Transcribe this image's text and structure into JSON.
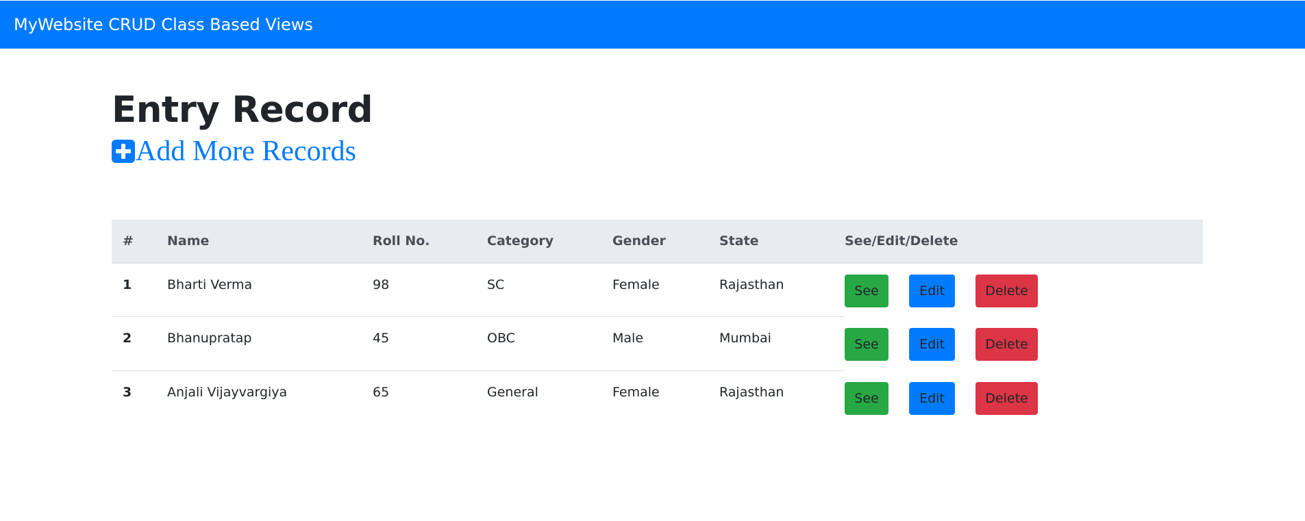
{
  "navbar": {
    "brand": "MyWebsite CRUD Class Based Views"
  },
  "page": {
    "title": "Entry Record",
    "add_link_label": "Add More Records",
    "add_icon": "plus-square-icon"
  },
  "colors": {
    "primary": "#007bff",
    "success": "#28a745",
    "danger": "#dc3545",
    "header_bg": "#e9ecef"
  },
  "table": {
    "headers": [
      "#",
      "Name",
      "Roll No.",
      "Category",
      "Gender",
      "State",
      "See/Edit/Delete"
    ],
    "rows": [
      {
        "idx": "1",
        "name": "Bharti Verma",
        "roll": "98",
        "category": "SC",
        "gender": "Female",
        "state": "Rajasthan"
      },
      {
        "idx": "2",
        "name": "Bhanupratap",
        "roll": "45",
        "category": "OBC",
        "gender": "Male",
        "state": "Mumbai"
      },
      {
        "idx": "3",
        "name": "Anjali Vijayvargiya",
        "roll": "65",
        "category": "General",
        "gender": "Female",
        "state": "Rajasthan"
      }
    ],
    "actions": {
      "see": "See",
      "edit": "Edit",
      "delete": "Delete"
    }
  }
}
